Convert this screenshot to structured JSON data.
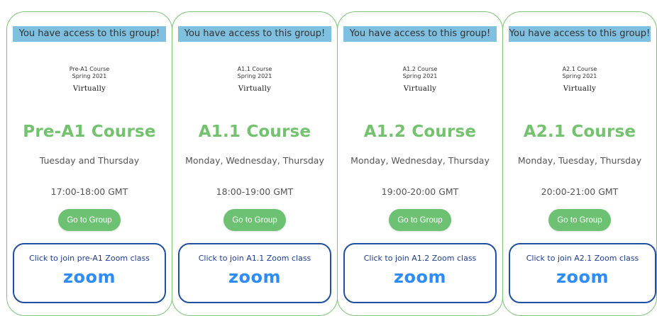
{
  "cards": [
    {
      "banner": "You have access to this group!",
      "logo_line1": "Pre-A1 Course",
      "logo_line2": "Spring 2021",
      "logo_brand": "Virtually",
      "title": "Pre-A1 Course",
      "days": "Tuesday and Thursday",
      "time": "17:00-18:00 GMT",
      "button": "Go to Group",
      "zoom_text": "Click to join pre-A1 Zoom class",
      "zoom_logo": "zoom"
    },
    {
      "banner": "You have access to this group!",
      "logo_line1": "A1.1 Course",
      "logo_line2": "Spring 2021",
      "logo_brand": "Virtually",
      "title": "A1.1 Course",
      "days": "Monday, Wednesday, Thursday",
      "time": "18:00-19:00 GMT",
      "button": "Go to Group",
      "zoom_text": "Click to join A1.1 Zoom class",
      "zoom_logo": "zoom"
    },
    {
      "banner": "You have access to this group!",
      "logo_line1": "A1.2 Course",
      "logo_line2": "Spring 2021",
      "logo_brand": "Virtually",
      "title": "A1.2 Course",
      "days": "Monday, Wednesday, Thursday",
      "time": "19:00-20:00 GMT",
      "button": "Go to Group",
      "zoom_text": "Click to join A1.2 Zoom class",
      "zoom_logo": "zoom"
    },
    {
      "banner": "You have access to this group!",
      "logo_line1": "A2.1 Course",
      "logo_line2": "Spring 2021",
      "logo_brand": "Virtually",
      "title": "A2.1 Course",
      "days": "Monday, Tuesday, Thursday",
      "time": "20:00-21:00 GMT",
      "button": "Go to Group",
      "zoom_text": "Click to join A2.1 Zoom class",
      "zoom_logo": "zoom"
    }
  ],
  "colors": {
    "accent_green": "#72c26e",
    "banner_blue": "#7fbfe0",
    "zoom_border": "#1f4fa0",
    "zoom_blue": "#2d8cff"
  }
}
